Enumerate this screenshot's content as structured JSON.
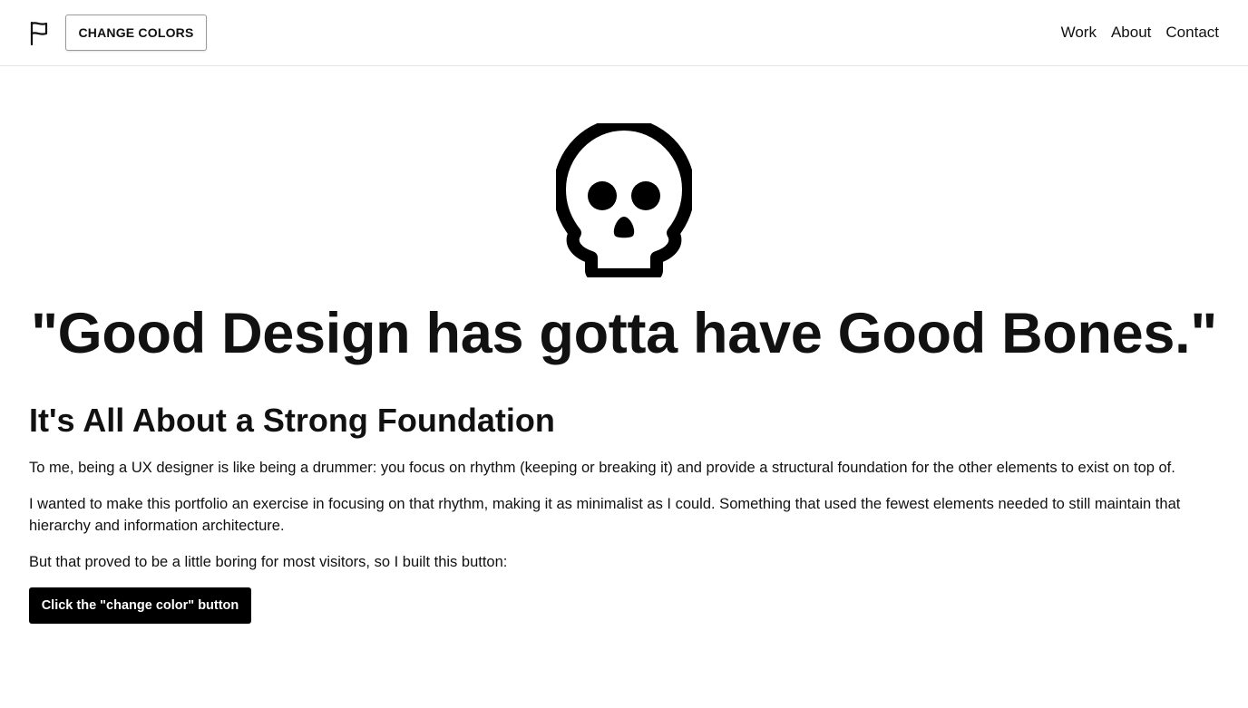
{
  "header": {
    "logo_icon": "flag-icon",
    "change_colors_label": "CHANGE COLORS",
    "nav": [
      {
        "label": "Work"
      },
      {
        "label": "About"
      },
      {
        "label": "Contact"
      }
    ]
  },
  "hero": {
    "icon": "skull-icon",
    "quote": "\"Good Design has gotta have Good Bones.\""
  },
  "section": {
    "title": "It's All About a Strong Foundation",
    "paragraphs": [
      "To me, being a UX designer is like being a drummer: you focus on rhythm (keeping or breaking it) and provide a structural foundation for the other elements to exist on top of.",
      "I wanted to make this portfolio an exercise in focusing on that rhythm, making it as minimalist as I could. Something that used the fewest elements needed to still maintain that hierarchy and information architecture.",
      "But that proved to be a little boring for most visitors, so I built this button:"
    ],
    "cta_label": "Click the \"change color\" button"
  },
  "colors": {
    "text": "#111111",
    "background": "#ffffff",
    "button_dark": "#000000"
  }
}
